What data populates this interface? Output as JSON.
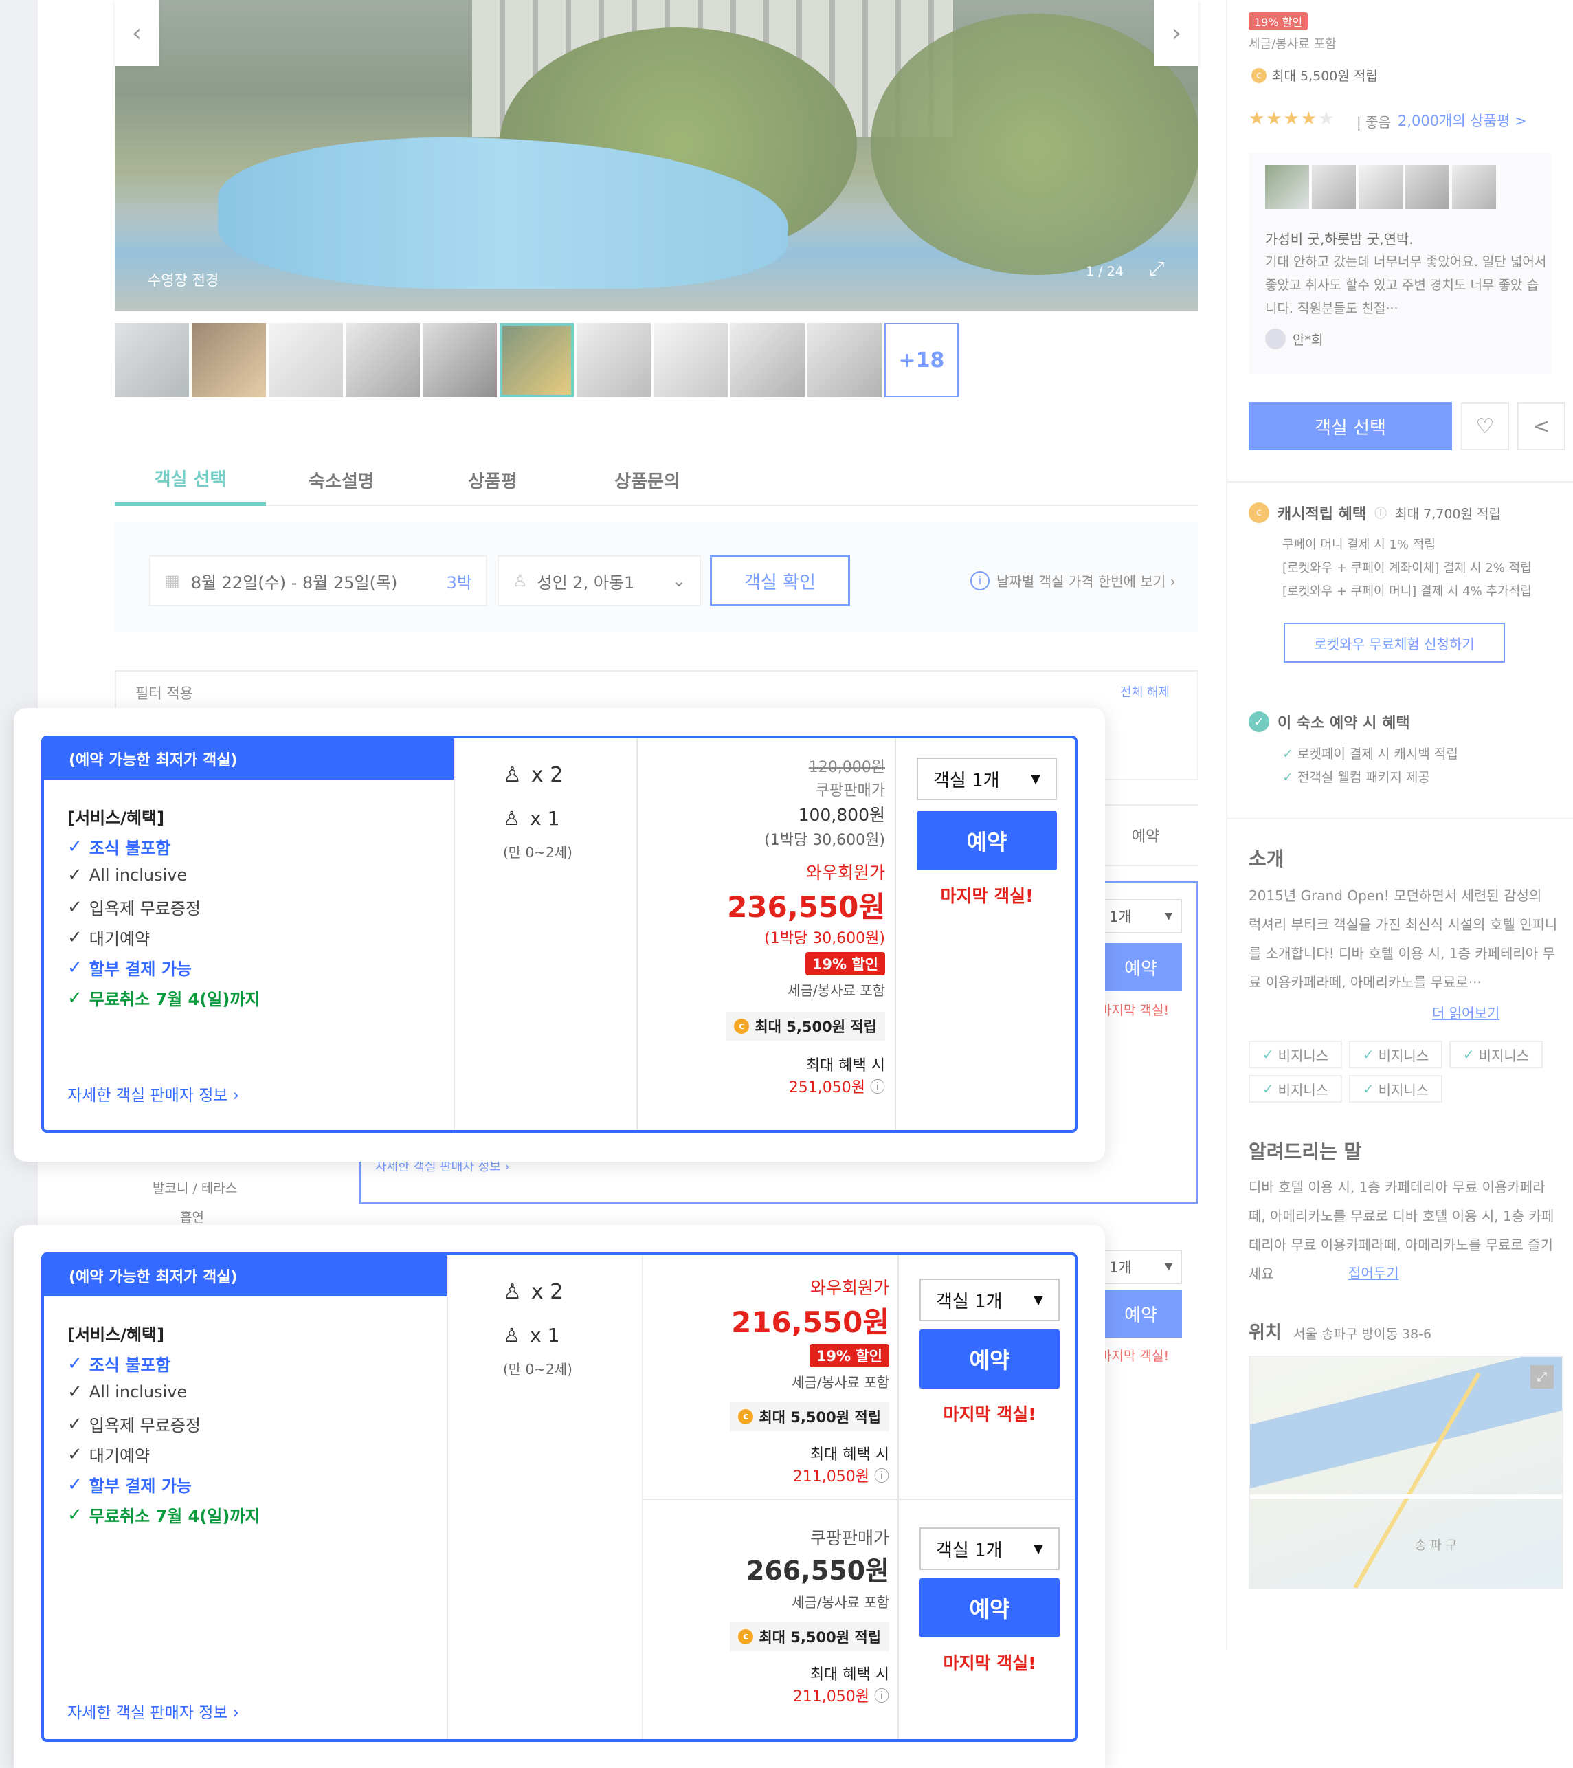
{
  "hero": {
    "caption": "수영장 전경",
    "counter": "1 / 24",
    "more_photos": "+18"
  },
  "tabs": [
    "객실 선택",
    "숙소설명",
    "상품평",
    "상품문의"
  ],
  "search": {
    "dates": "8월 22일(수) - 8월 25일(목)",
    "nights": "3박",
    "guests": "성인 2, 아동1",
    "check_button": "객실 확인",
    "daily_price_link": "날짜별 객실 가격 한번에 보기 ›"
  },
  "filter": {
    "label": "필터 적용",
    "clear": "전체 해제"
  },
  "back_layer": {
    "reserve_header": "예약",
    "qty": "1개",
    "reserve": "예약",
    "last_room": "마지막 객실!",
    "seller_link": "자세한 객실 판매자 정보 ›",
    "amenities": [
      "발코니 / 테라스",
      "흡연"
    ]
  },
  "card1": {
    "ribbon": "(예약 가능한 최저가 객실)",
    "services_title": "[서비스/혜택]",
    "services": [
      {
        "text": "조식 불포함",
        "style": "blue"
      },
      {
        "text": "All inclusive",
        "style": "gray"
      },
      {
        "text": "입욕제 무료증정",
        "style": "gray"
      },
      {
        "text": "대기예약",
        "style": "gray"
      },
      {
        "text": "할부 결제 가능",
        "style": "blue"
      },
      {
        "text": "무료취소 7월 4(일)까지",
        "style": "green"
      }
    ],
    "seller_link": "자세한 객실 판매자 정보 ›",
    "adults": "x 2",
    "children": "x 1",
    "child_age": "(만 0~2세)",
    "original_price": "120,000원",
    "coupang_label": "쿠팡판매가",
    "coupang_price": "100,800원",
    "coupang_nightly": "(1박당 30,600원)",
    "wow_label": "와우회원가",
    "wow_price": "236,550원",
    "wow_nightly": "(1박당 30,600원)",
    "discount": "19% 할인",
    "tax": "세금/봉사료 포함",
    "points": "최대 5,500원 적립",
    "max_benefit_label": "최대 혜택 시",
    "max_benefit_price": "251,050원",
    "qty": "객실 1개",
    "reserve": "예약",
    "last_room": "마지막 객실!"
  },
  "card2": {
    "ribbon": "(예약 가능한 최저가 객실)",
    "services_title": "[서비스/혜택]",
    "services": [
      {
        "text": "조식 불포함",
        "style": "blue"
      },
      {
        "text": "All inclusive",
        "style": "gray"
      },
      {
        "text": "입욕제 무료증정",
        "style": "gray"
      },
      {
        "text": "대기예약",
        "style": "gray"
      },
      {
        "text": "할부 결제 가능",
        "style": "blue"
      },
      {
        "text": "무료취소 7월 4(일)까지",
        "style": "green"
      }
    ],
    "seller_link": "자세한 객실 판매자 정보 ›",
    "adults": "x 2",
    "children": "x 1",
    "child_age": "(만 0~2세)",
    "row1": {
      "label": "와우회원가",
      "price": "216,550원",
      "discount": "19% 할인",
      "tax": "세금/봉사료 포함",
      "points": "최대 5,500원 적립",
      "max_label": "최대 혜택 시",
      "max_price": "211,050원",
      "qty": "객실 1개",
      "reserve": "예약",
      "last_room": "마지막 객실!"
    },
    "row2": {
      "label": "쿠팡판매가",
      "price": "266,550원",
      "tax": "세금/봉사료 포함",
      "points": "최대 5,500원 적립",
      "max_label": "최대 혜택 시",
      "max_price": "211,050원",
      "qty": "객실 1개",
      "reserve": "예약",
      "last_room": "마지막 객실!"
    }
  },
  "sidebar": {
    "discount": "19% 할인",
    "tax": "세금/봉사료 포함",
    "points": "최대 5,500원 적립",
    "rating_text": "| 좋음",
    "review_link": "2,000개의 상품평 >",
    "review_title": "가성비 굿,하룻밤 굿,연박.",
    "review_body": "기대 안하고 갔는데 너무너무 좋았어요. 일단 넓어서 좋았고 취사도 할수 있고 주변 경치도 너무 좋았 습니다. 직원분들도 친절···",
    "reviewer": "안*희",
    "select_button": "객실 선택",
    "cash_title": "캐시적립 혜택",
    "cash_max": "최대 7,700원 적립",
    "cash_lines": [
      "쿠페이 머니 결제 시 1% 적립",
      "[로켓와우 + 쿠페이 계좌이체] 결제 시 2% 적립",
      "[로켓와우 + 쿠페이 머니] 결제 시 4% 추가적립"
    ],
    "rocket_button": "로켓와우 무료체험 신청하기",
    "benefit_title": "이 숙소 예약 시 혜택",
    "benefits": [
      "로켓페이 결제 시 캐시백 적립",
      "전객실 웰컴 패키지 제공"
    ],
    "intro_title": "소개",
    "intro_body": "2015년 Grand Open! 모던하면서 세련된 감성의 럭셔리 부티크 객실을 가진 최신식 시설의 호텔 인피니를 소개합니다! 디바 호텔 이용 시, 1층 카페테리아 무료 이용카페라떼, 아메리카노를 무료로···",
    "read_more": "더 읽어보기",
    "chips": [
      "비지니스",
      "비지니스",
      "비지니스",
      "비지니스",
      "비지니스"
    ],
    "notice_title": "알려드리는 말",
    "notice_body": "디바 호텔 이용 시, 1층 카페테리아 무료 이용카페라떼, 아메리카노를 무료로 디바 호텔 이용 시, 1층 카페테리아 무료 이용카페라떼, 아메리카노를 무료로 즐기세요",
    "fold": "접어두기",
    "location_title": "위치",
    "address": "서울 송파구 방이동 38-6",
    "map_label": "송 파 구"
  }
}
